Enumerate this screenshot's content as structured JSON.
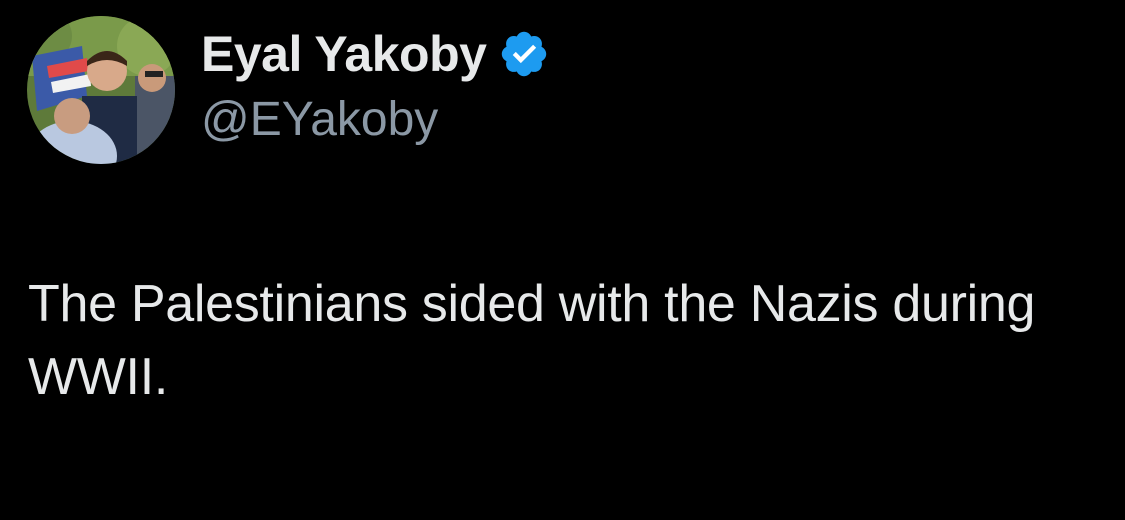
{
  "tweet": {
    "author": {
      "display_name": "Eyal Yakoby",
      "handle": "@EYakoby",
      "verified": true,
      "avatar_icon": "profile-photo"
    },
    "text": "The Palestinians sided with the Nazis during WWII."
  },
  "colors": {
    "background": "#000000",
    "primary_text": "#e7e9ea",
    "secondary_text": "#8b98a5",
    "verified_badge": "#1d9bf0"
  }
}
